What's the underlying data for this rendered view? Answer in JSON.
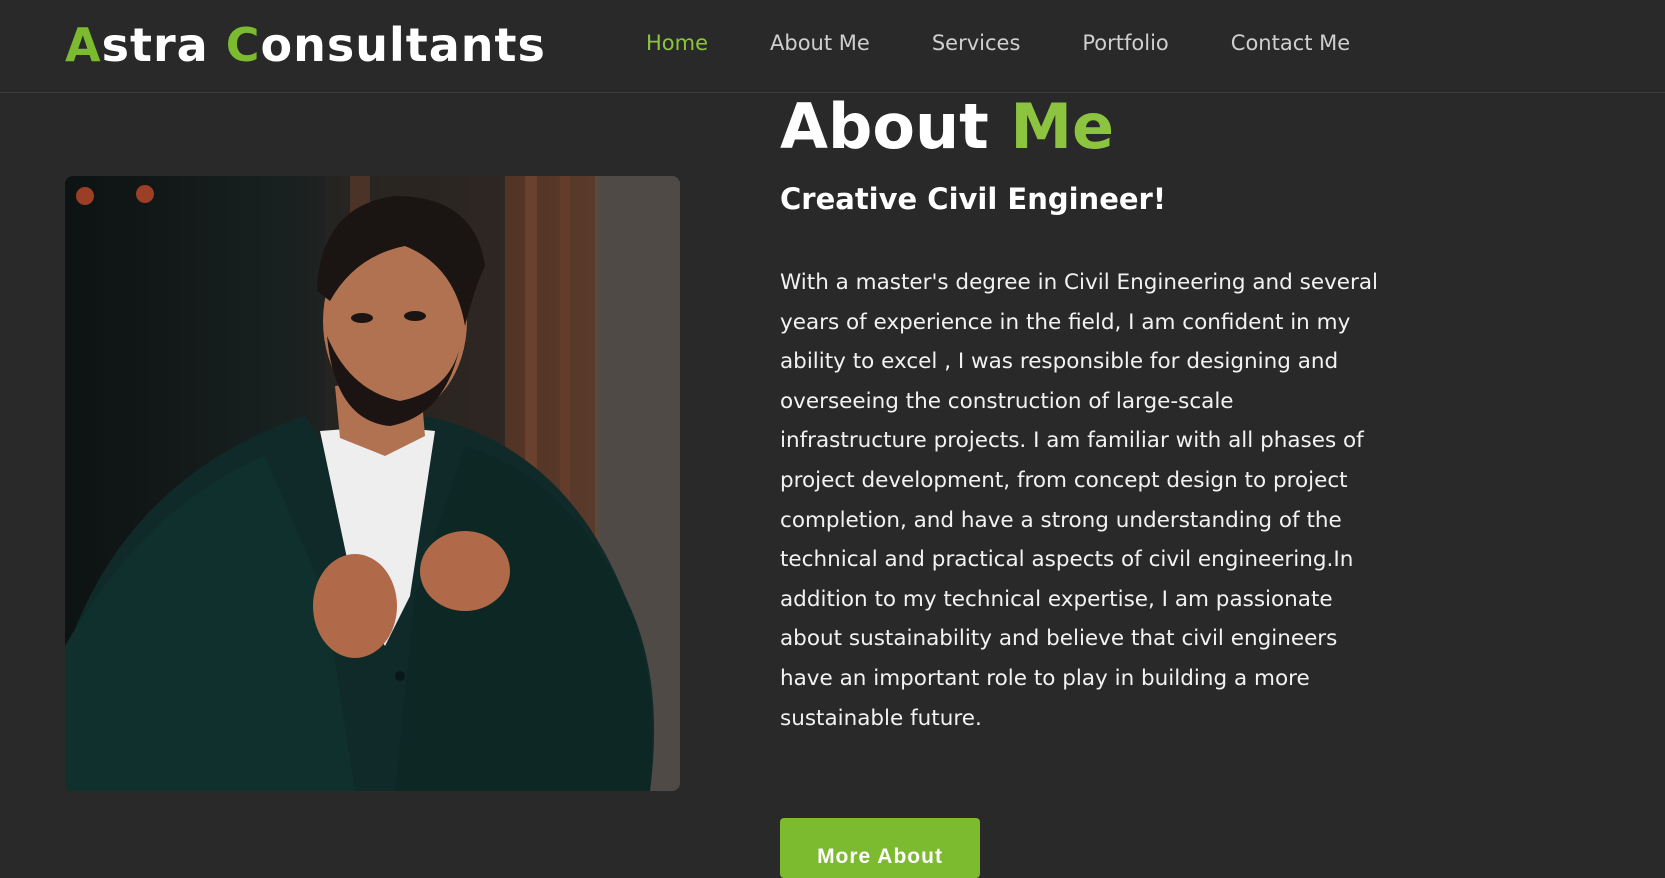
{
  "header": {
    "logo": {
      "part1_initial": "A",
      "part1_rest": "stra ",
      "part2_initial": "C",
      "part2_rest": "onsultants"
    },
    "nav": [
      {
        "label": "Home",
        "active": true
      },
      {
        "label": "About Me",
        "active": false
      },
      {
        "label": "Services",
        "active": false
      },
      {
        "label": "Portfolio",
        "active": false
      },
      {
        "label": "Contact Me",
        "active": false
      }
    ]
  },
  "about": {
    "title_main": "About ",
    "title_accent": "Me",
    "subtitle": "Creative Civil Engineer!",
    "bio_lines": [
      "With a master's degree in Civil Engineering and several",
      "years of experience in the field, I am confident in my",
      "ability to excel , I was responsible for designing and",
      "overseeing the construction of large-scale",
      "infrastructure projects. I am familiar with all phases of",
      "project development, from concept design to project",
      "completion, and have a strong understanding of the",
      "technical and practical aspects of civil engineering.In",
      "addition to my technical expertise, I am passionate",
      "about sustainability and believe that civil engineers",
      "have an important role to play in building a more",
      "sustainable future."
    ],
    "button_label": "More About"
  },
  "colors": {
    "background": "#292929",
    "accent": "#8cc43f",
    "button": "#7cba2f",
    "nav_text": "#cfcfcf"
  }
}
